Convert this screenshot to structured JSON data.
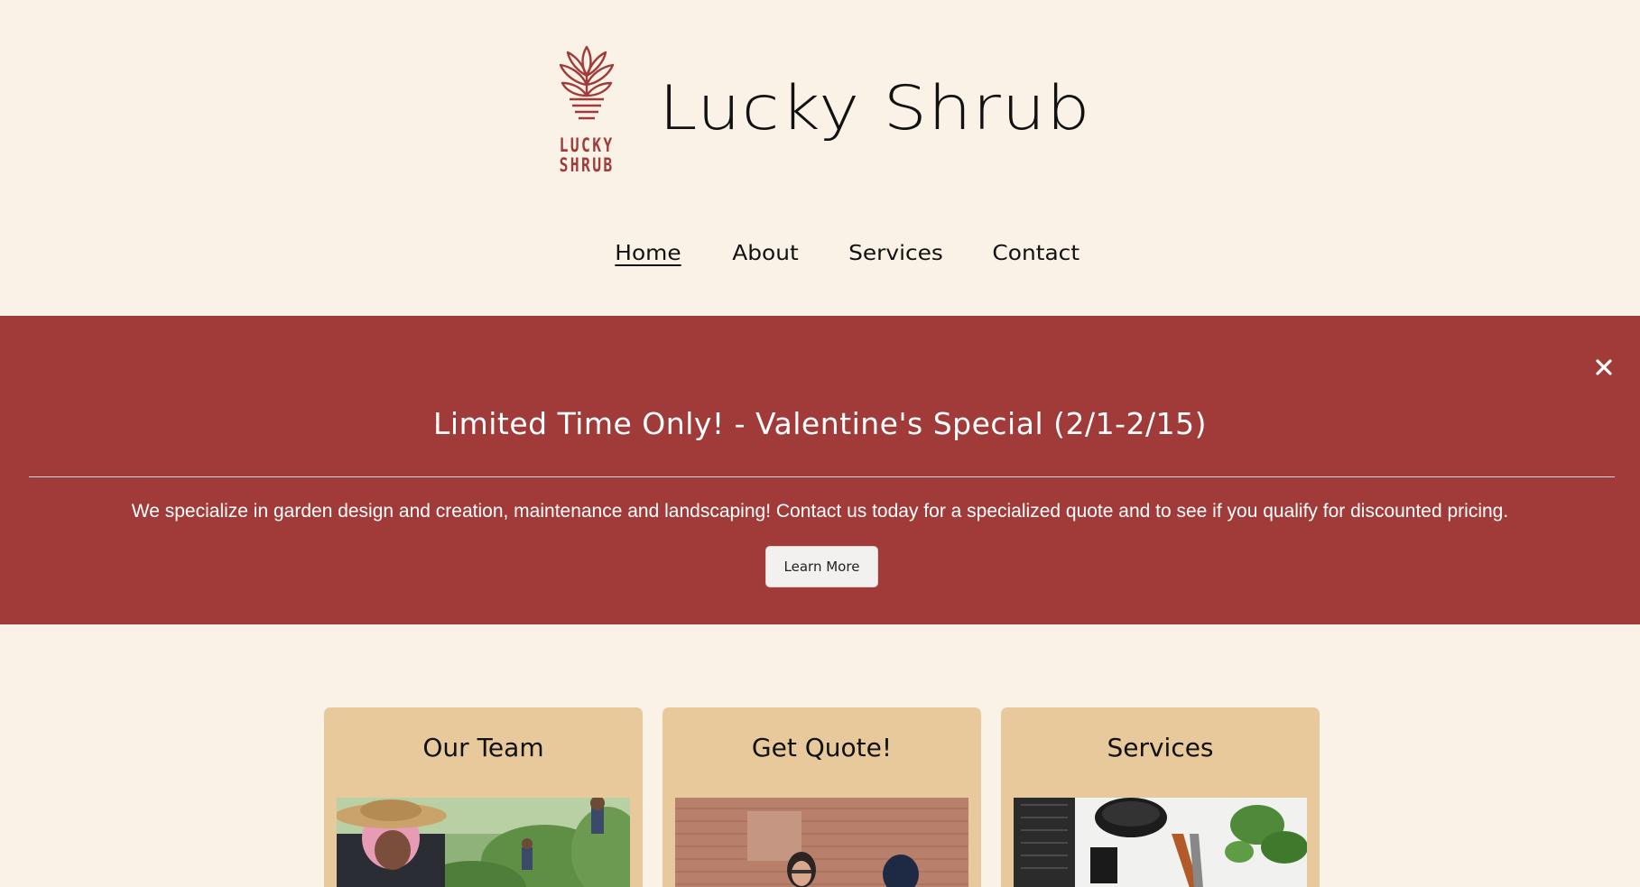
{
  "header": {
    "logo_word_top": "LUCKY",
    "logo_word_bottom": "SHRUB",
    "site_title": "Lucky Shrub"
  },
  "nav": {
    "items": [
      {
        "label": "Home",
        "active": true
      },
      {
        "label": "About",
        "active": false
      },
      {
        "label": "Services",
        "active": false
      },
      {
        "label": "Contact",
        "active": false
      }
    ]
  },
  "promo": {
    "title": "Limited Time Only! - Valentine's Special (2/1-2/15)",
    "text": "We specialize in garden design and creation, maintenance and landscaping! Contact us today for a specialized quote and to see if you qualify for discounted pricing.",
    "button_label": "Learn More",
    "close_icon": "close-icon"
  },
  "cards": [
    {
      "title": "Our Team",
      "image": "gardener-with-hat-photo"
    },
    {
      "title": "Get Quote!",
      "image": "consultation-photo"
    },
    {
      "title": "Services",
      "image": "garden-tools-photo"
    }
  ],
  "colors": {
    "page_bg": "#faf2e6",
    "brand_red": "#a03b3a",
    "card_bg": "#e8c99c",
    "button_bg": "#f3f1ef"
  }
}
